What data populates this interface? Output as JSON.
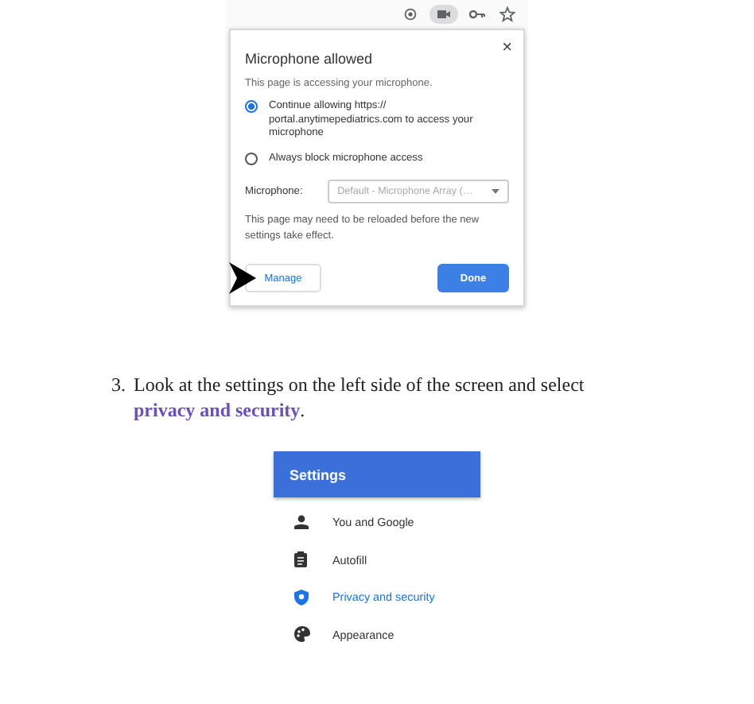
{
  "browser_toolbar": {
    "icons": [
      {
        "kind": "location",
        "selected": false
      },
      {
        "kind": "camera",
        "selected": true
      },
      {
        "kind": "key",
        "selected": false
      },
      {
        "kind": "star",
        "selected": false
      }
    ]
  },
  "permission_popup": {
    "title": "Microphone allowed",
    "close": "×",
    "description": "This page is accessing your microphone.",
    "options": [
      {
        "label": "Continue allowing https:// portal.anytimepediatrics.com to access your microphone",
        "selected": true
      },
      {
        "label": "Always block microphone access",
        "selected": false
      }
    ],
    "microphone_label": "Microphone:",
    "microphone_select": "Default - Microphone Array (…",
    "note": "This page may need to be reloaded before the new settings take effect.",
    "manage_button": "Manage",
    "done_button": "Done"
  },
  "step": {
    "number": "3.",
    "text": "Look at the settings on the left side of the screen and select ",
    "link": "privacy and security",
    "end": "."
  },
  "settings_panel": {
    "title": "Settings",
    "items": [
      {
        "label": "You and Google",
        "kind": "person",
        "selected": false
      },
      {
        "label": "Autofill",
        "kind": "clipboard",
        "selected": false
      },
      {
        "label": "Privacy and security",
        "kind": "shield",
        "selected": true
      },
      {
        "label": "Appearance",
        "kind": "palette",
        "selected": false
      }
    ]
  }
}
